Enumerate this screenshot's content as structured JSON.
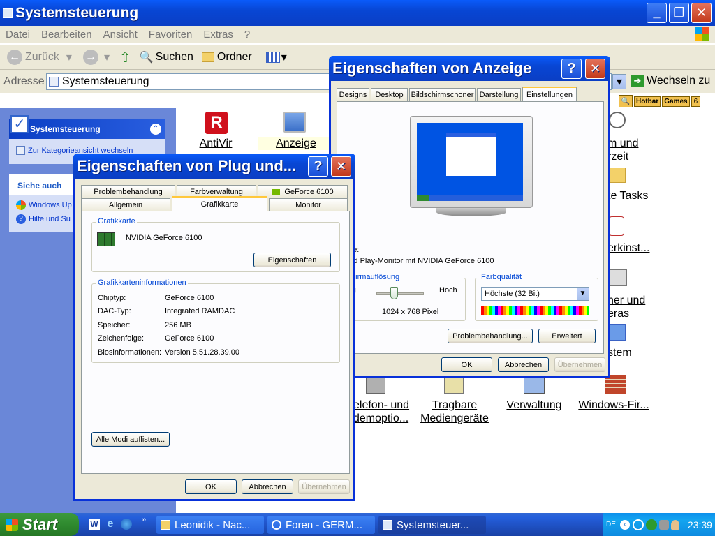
{
  "main_window": {
    "title": "Systemsteuerung",
    "menu": [
      "Datei",
      "Bearbeiten",
      "Ansicht",
      "Favoriten",
      "Extras",
      "?"
    ],
    "toolbar": {
      "back": "Zurück",
      "search": "Suchen",
      "folders": "Ordner"
    },
    "address_label": "Adresse",
    "address_value": "Systemsteuerung",
    "go_label": "Wechseln zu",
    "linkbar": [
      "Hotbar",
      "Games",
      "6"
    ]
  },
  "sidebar": {
    "panel1_title": "Systemsteuerung",
    "panel1_link": "Zur Kategorieansicht wechseln",
    "panel2_title": "Siehe auch",
    "panel2_links": [
      "Windows Up",
      "Hilfe und Su"
    ]
  },
  "items": {
    "antivir": "AntiVir",
    "anzeige": "Anzeige",
    "datum_1": "m und",
    "datum_2": "rzeit",
    "tasks": "te Tasks",
    "maus": "erkinst...",
    "scanner_1": "ner und",
    "scanner_2": "eras",
    "system": "stem",
    "telefon_1": "elefon- und",
    "telefon_2": "demoptio...",
    "tragbar_1": "Tragbare",
    "tragbar_2": "Mediengeräte",
    "verwaltung": "Verwaltung",
    "firewall": "Windows-Fir..."
  },
  "display_dialog": {
    "title": "Eigenschaften von Anzeige",
    "tabs": [
      "Designs",
      "Desktop",
      "Bildschirmschoner",
      "Darstellung",
      "Einstellungen"
    ],
    "anzeige_label": "zeige:",
    "monitor_text": "g und Play-Monitor mit NVIDIA GeForce 6100",
    "resolution_label": "ildschirmauflösung",
    "low": "iedrig",
    "high": "Hoch",
    "resolution_value": "1024 x 768 Pixel",
    "color_label": "Farbqualität",
    "color_value": "Höchste (32 Bit)",
    "troubleshoot": "Problembehandlung...",
    "advanced": "Erweitert",
    "ok": "OK",
    "cancel": "Abbrechen",
    "apply": "Übernehmen"
  },
  "pnp_dialog": {
    "title": "Eigenschaften von Plug und...",
    "tabs_row1": [
      "Problembehandlung",
      "Farbverwaltung",
      "GeForce 6100"
    ],
    "tabs_row2": [
      "Allgemein",
      "Grafikkarte",
      "Monitor"
    ],
    "adapter_group": "Grafikkarte",
    "adapter_name": "NVIDIA GeForce 6100",
    "properties": "Eigenschaften",
    "info_group": "Grafikkarteninformationen",
    "info": [
      {
        "k": "Chiptyp:",
        "v": "GeForce 6100"
      },
      {
        "k": "DAC-Typ:",
        "v": "Integrated RAMDAC"
      },
      {
        "k": "Speicher:",
        "v": "256 MB"
      },
      {
        "k": "Zeichenfolge:",
        "v": "GeForce 6100"
      },
      {
        "k": "Biosinformationen:",
        "v": "Version 5.51.28.39.00"
      }
    ],
    "list_modes": "Alle Modi auflisten...",
    "ok": "OK",
    "cancel": "Abbrechen",
    "apply": "Übernehmen"
  },
  "taskbar": {
    "start": "Start",
    "tasks": [
      "Leonidik - Nac...",
      "Foren - GERM...",
      "Systemsteuer..."
    ],
    "lang": "DE",
    "time": "23:39"
  }
}
